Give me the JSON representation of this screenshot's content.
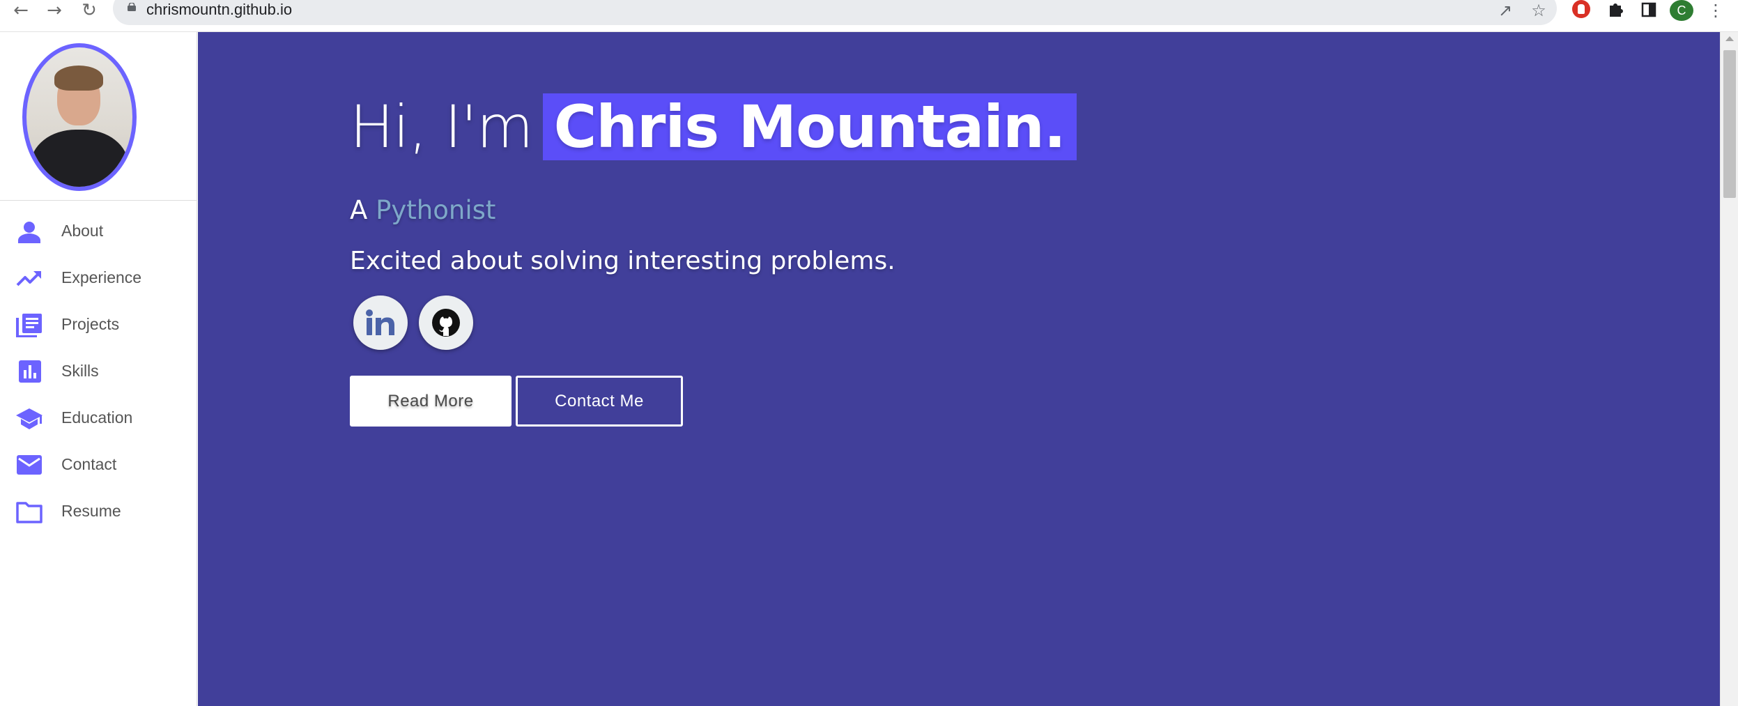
{
  "browser": {
    "url": "chrismountn.github.io",
    "profile_initial": "C",
    "icons": [
      "back-icon",
      "forward-icon",
      "reload-icon",
      "lock-icon",
      "share-icon",
      "bookmark-star-icon",
      "extension-red-icon",
      "extensions-puzzle-icon",
      "side-panel-icon",
      "profile-avatar",
      "menu-kebab-icon"
    ]
  },
  "sidebar": {
    "items": [
      {
        "label": "About",
        "icon": "person-icon"
      },
      {
        "label": "Experience",
        "icon": "trending-up-icon"
      },
      {
        "label": "Projects",
        "icon": "library-books-icon"
      },
      {
        "label": "Skills",
        "icon": "bar-chart-icon"
      },
      {
        "label": "Education",
        "icon": "graduation-cap-icon"
      },
      {
        "label": "Contact",
        "icon": "mail-icon"
      },
      {
        "label": "Resume",
        "icon": "folder-icon"
      }
    ]
  },
  "hero": {
    "greeting": "Hi, I'm",
    "name": "Chris Mountain.",
    "role_prefix": "A",
    "role": "Pythonist",
    "tagline": "Excited about solving interesting problems.",
    "social": [
      "linkedin-icon",
      "github-icon"
    ],
    "read_more": "Read More",
    "contact_me": "Contact Me"
  },
  "colors": {
    "accent": "#6c63ff",
    "hero_background": "#413f9a",
    "name_highlight": "#5b4ef8",
    "role_text": "#7ea8c9",
    "sidebar_text": "#555555"
  }
}
